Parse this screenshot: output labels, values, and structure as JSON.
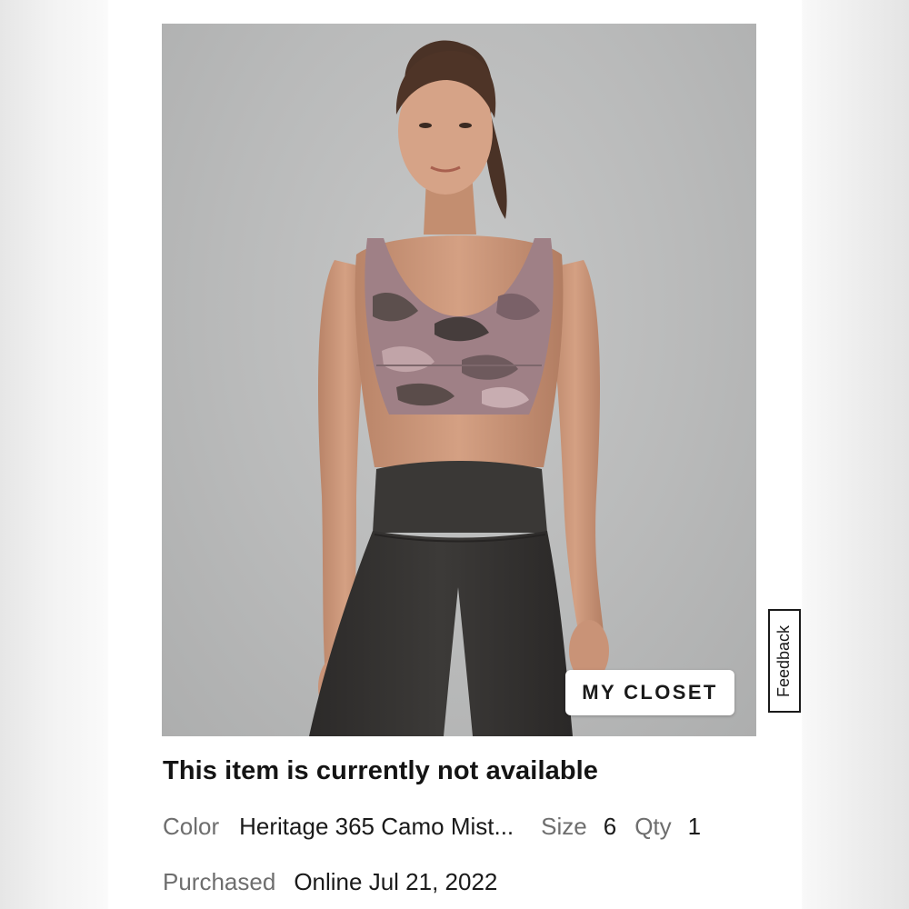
{
  "closet_button": {
    "label": "MY CLOSET"
  },
  "feedback_tab": {
    "label": "Feedback"
  },
  "availability": {
    "message": "This item is currently not available"
  },
  "details": {
    "color_label": "Color",
    "color_value": "Heritage 365 Camo Mist...",
    "size_label": "Size",
    "size_value": "6",
    "qty_label": "Qty",
    "qty_value": "1",
    "purchased_label": "Purchased",
    "purchased_value": "Online Jul 21, 2022"
  }
}
